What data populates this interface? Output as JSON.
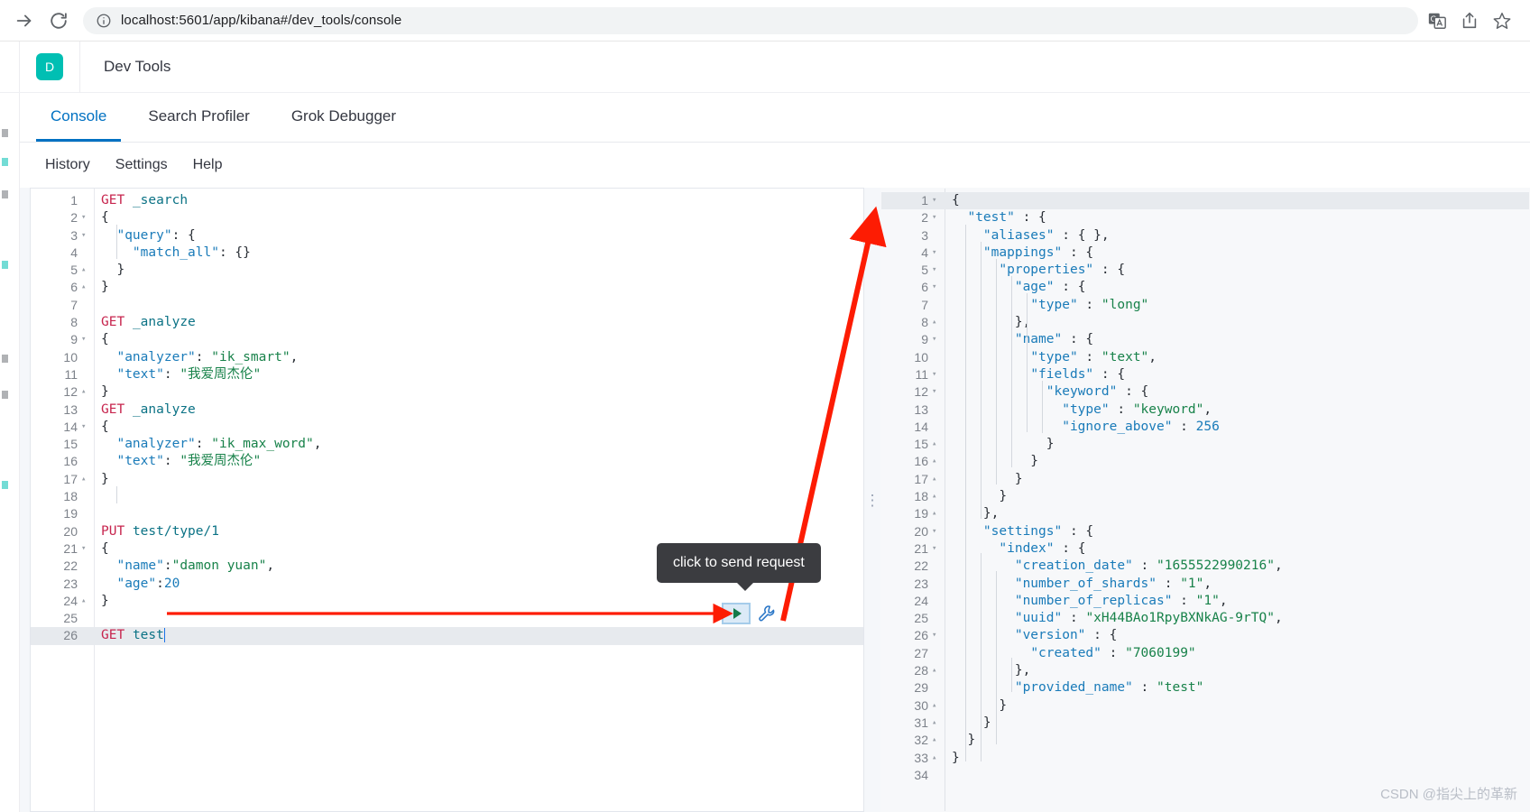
{
  "browser": {
    "url_host": "localhost:5601",
    "url_path": "/app/kibana#/dev_tools/console",
    "url_full": "localhost:5601/app/kibana#/dev_tools/console",
    "icons": {
      "forward": "forward-arrow-icon",
      "reload": "reload-icon",
      "info": "site-info-icon",
      "translate": "translate-icon",
      "share": "share-icon",
      "bookmark": "bookmark-star-icon"
    }
  },
  "header": {
    "logo_letter": "D",
    "logo_color": "#00bfb3",
    "title": "Dev Tools"
  },
  "tabs": [
    {
      "label": "Console",
      "active": true
    },
    {
      "label": "Search Profiler",
      "active": false
    },
    {
      "label": "Grok Debugger",
      "active": false
    }
  ],
  "submenu": [
    {
      "label": "History"
    },
    {
      "label": "Settings"
    },
    {
      "label": "Help"
    }
  ],
  "accent_color": "#0071c2",
  "request_editor": {
    "name": "console-request-editor",
    "highlighted_line": 26,
    "caret_line": 26,
    "lines": [
      {
        "n": 1,
        "fold": "",
        "tokens": [
          {
            "c": "t-method",
            "t": "GET"
          },
          {
            "c": "t-plain",
            "t": " "
          },
          {
            "c": "t-url",
            "t": "_search"
          }
        ]
      },
      {
        "n": 2,
        "fold": "▾",
        "tokens": [
          {
            "c": "t-punc",
            "t": "{"
          }
        ]
      },
      {
        "n": 3,
        "fold": "▾",
        "tokens": [
          {
            "c": "t-plain",
            "t": "  "
          },
          {
            "c": "t-key",
            "t": "\"query\""
          },
          {
            "c": "t-punc",
            "t": ": {"
          }
        ]
      },
      {
        "n": 4,
        "fold": "",
        "tokens": [
          {
            "c": "t-plain",
            "t": "    "
          },
          {
            "c": "t-key",
            "t": "\"match_all\""
          },
          {
            "c": "t-punc",
            "t": ": {}"
          }
        ]
      },
      {
        "n": 5,
        "fold": "▴",
        "tokens": [
          {
            "c": "t-punc",
            "t": "  }"
          }
        ]
      },
      {
        "n": 6,
        "fold": "▴",
        "tokens": [
          {
            "c": "t-punc",
            "t": "}"
          }
        ]
      },
      {
        "n": 7,
        "fold": "",
        "tokens": []
      },
      {
        "n": 8,
        "fold": "",
        "tokens": [
          {
            "c": "t-method",
            "t": "GET"
          },
          {
            "c": "t-plain",
            "t": " "
          },
          {
            "c": "t-url",
            "t": "_analyze"
          }
        ]
      },
      {
        "n": 9,
        "fold": "▾",
        "tokens": [
          {
            "c": "t-punc",
            "t": "{"
          }
        ]
      },
      {
        "n": 10,
        "fold": "",
        "tokens": [
          {
            "c": "t-plain",
            "t": "  "
          },
          {
            "c": "t-key",
            "t": "\"analyzer\""
          },
          {
            "c": "t-punc",
            "t": ": "
          },
          {
            "c": "t-str",
            "t": "\"ik_smart\""
          },
          {
            "c": "t-punc",
            "t": ","
          }
        ]
      },
      {
        "n": 11,
        "fold": "",
        "tokens": [
          {
            "c": "t-plain",
            "t": "  "
          },
          {
            "c": "t-key",
            "t": "\"text\""
          },
          {
            "c": "t-punc",
            "t": ": "
          },
          {
            "c": "t-str",
            "t": "\"我爱周杰伦\""
          }
        ]
      },
      {
        "n": 12,
        "fold": "▴",
        "tokens": [
          {
            "c": "t-punc",
            "t": "}"
          }
        ]
      },
      {
        "n": 13,
        "fold": "",
        "tokens": [
          {
            "c": "t-method",
            "t": "GET"
          },
          {
            "c": "t-plain",
            "t": " "
          },
          {
            "c": "t-url",
            "t": "_analyze"
          }
        ]
      },
      {
        "n": 14,
        "fold": "▾",
        "tokens": [
          {
            "c": "t-punc",
            "t": "{"
          }
        ]
      },
      {
        "n": 15,
        "fold": "",
        "tokens": [
          {
            "c": "t-plain",
            "t": "  "
          },
          {
            "c": "t-key",
            "t": "\"analyzer\""
          },
          {
            "c": "t-punc",
            "t": ": "
          },
          {
            "c": "t-str",
            "t": "\"ik_max_word\""
          },
          {
            "c": "t-punc",
            "t": ","
          }
        ]
      },
      {
        "n": 16,
        "fold": "",
        "tokens": [
          {
            "c": "t-plain",
            "t": "  "
          },
          {
            "c": "t-key",
            "t": "\"text\""
          },
          {
            "c": "t-punc",
            "t": ": "
          },
          {
            "c": "t-str",
            "t": "\"我爱周杰伦\""
          }
        ]
      },
      {
        "n": 17,
        "fold": "▴",
        "tokens": [
          {
            "c": "t-punc",
            "t": "}"
          }
        ]
      },
      {
        "n": 18,
        "fold": "",
        "tokens": []
      },
      {
        "n": 19,
        "fold": "",
        "tokens": []
      },
      {
        "n": 20,
        "fold": "",
        "tokens": [
          {
            "c": "t-method",
            "t": "PUT"
          },
          {
            "c": "t-plain",
            "t": " "
          },
          {
            "c": "t-url",
            "t": "test/type/1"
          }
        ]
      },
      {
        "n": 21,
        "fold": "▾",
        "tokens": [
          {
            "c": "t-punc",
            "t": "{"
          }
        ]
      },
      {
        "n": 22,
        "fold": "",
        "tokens": [
          {
            "c": "t-plain",
            "t": "  "
          },
          {
            "c": "t-key",
            "t": "\"name\""
          },
          {
            "c": "t-punc",
            "t": ":"
          },
          {
            "c": "t-str",
            "t": "\"damon yuan\""
          },
          {
            "c": "t-punc",
            "t": ","
          }
        ]
      },
      {
        "n": 23,
        "fold": "",
        "tokens": [
          {
            "c": "t-plain",
            "t": "  "
          },
          {
            "c": "t-key",
            "t": "\"age\""
          },
          {
            "c": "t-punc",
            "t": ":"
          },
          {
            "c": "t-num",
            "t": "20"
          }
        ]
      },
      {
        "n": 24,
        "fold": "▴",
        "tokens": [
          {
            "c": "t-punc",
            "t": "}"
          }
        ]
      },
      {
        "n": 25,
        "fold": "",
        "tokens": []
      },
      {
        "n": 26,
        "fold": "",
        "tokens": [
          {
            "c": "t-method",
            "t": "GET"
          },
          {
            "c": "t-plain",
            "t": " "
          },
          {
            "c": "t-url",
            "t": "test"
          }
        ]
      }
    ]
  },
  "response_editor": {
    "name": "console-response-viewer",
    "highlighted_line": 1,
    "lines": [
      {
        "n": 1,
        "fold": "▾",
        "tokens": [
          {
            "c": "t-punc",
            "t": "{"
          }
        ]
      },
      {
        "n": 2,
        "fold": "▾",
        "tokens": [
          {
            "c": "t-plain",
            "t": "  "
          },
          {
            "c": "t-key",
            "t": "\"test\""
          },
          {
            "c": "t-punc",
            "t": " : {"
          }
        ]
      },
      {
        "n": 3,
        "fold": "",
        "tokens": [
          {
            "c": "t-plain",
            "t": "    "
          },
          {
            "c": "t-key",
            "t": "\"aliases\""
          },
          {
            "c": "t-punc",
            "t": " : { },"
          }
        ]
      },
      {
        "n": 4,
        "fold": "▾",
        "tokens": [
          {
            "c": "t-plain",
            "t": "    "
          },
          {
            "c": "t-key",
            "t": "\"mappings\""
          },
          {
            "c": "t-punc",
            "t": " : {"
          }
        ]
      },
      {
        "n": 5,
        "fold": "▾",
        "tokens": [
          {
            "c": "t-plain",
            "t": "      "
          },
          {
            "c": "t-key",
            "t": "\"properties\""
          },
          {
            "c": "t-punc",
            "t": " : {"
          }
        ]
      },
      {
        "n": 6,
        "fold": "▾",
        "tokens": [
          {
            "c": "t-plain",
            "t": "        "
          },
          {
            "c": "t-key",
            "t": "\"age\""
          },
          {
            "c": "t-punc",
            "t": " : {"
          }
        ]
      },
      {
        "n": 7,
        "fold": "",
        "tokens": [
          {
            "c": "t-plain",
            "t": "          "
          },
          {
            "c": "t-key",
            "t": "\"type\""
          },
          {
            "c": "t-punc",
            "t": " : "
          },
          {
            "c": "t-str",
            "t": "\"long\""
          }
        ]
      },
      {
        "n": 8,
        "fold": "▴",
        "tokens": [
          {
            "c": "t-punc",
            "t": "        },"
          }
        ]
      },
      {
        "n": 9,
        "fold": "▾",
        "tokens": [
          {
            "c": "t-plain",
            "t": "        "
          },
          {
            "c": "t-key",
            "t": "\"name\""
          },
          {
            "c": "t-punc",
            "t": " : {"
          }
        ]
      },
      {
        "n": 10,
        "fold": "",
        "tokens": [
          {
            "c": "t-plain",
            "t": "          "
          },
          {
            "c": "t-key",
            "t": "\"type\""
          },
          {
            "c": "t-punc",
            "t": " : "
          },
          {
            "c": "t-str",
            "t": "\"text\""
          },
          {
            "c": "t-punc",
            "t": ","
          }
        ]
      },
      {
        "n": 11,
        "fold": "▾",
        "tokens": [
          {
            "c": "t-plain",
            "t": "          "
          },
          {
            "c": "t-key",
            "t": "\"fields\""
          },
          {
            "c": "t-punc",
            "t": " : {"
          }
        ]
      },
      {
        "n": 12,
        "fold": "▾",
        "tokens": [
          {
            "c": "t-plain",
            "t": "            "
          },
          {
            "c": "t-key",
            "t": "\"keyword\""
          },
          {
            "c": "t-punc",
            "t": " : {"
          }
        ]
      },
      {
        "n": 13,
        "fold": "",
        "tokens": [
          {
            "c": "t-plain",
            "t": "              "
          },
          {
            "c": "t-key",
            "t": "\"type\""
          },
          {
            "c": "t-punc",
            "t": " : "
          },
          {
            "c": "t-str",
            "t": "\"keyword\""
          },
          {
            "c": "t-punc",
            "t": ","
          }
        ]
      },
      {
        "n": 14,
        "fold": "",
        "tokens": [
          {
            "c": "t-plain",
            "t": "              "
          },
          {
            "c": "t-key",
            "t": "\"ignore_above\""
          },
          {
            "c": "t-punc",
            "t": " : "
          },
          {
            "c": "t-num",
            "t": "256"
          }
        ]
      },
      {
        "n": 15,
        "fold": "▴",
        "tokens": [
          {
            "c": "t-punc",
            "t": "            }"
          }
        ]
      },
      {
        "n": 16,
        "fold": "▴",
        "tokens": [
          {
            "c": "t-punc",
            "t": "          }"
          }
        ]
      },
      {
        "n": 17,
        "fold": "▴",
        "tokens": [
          {
            "c": "t-punc",
            "t": "        }"
          }
        ]
      },
      {
        "n": 18,
        "fold": "▴",
        "tokens": [
          {
            "c": "t-punc",
            "t": "      }"
          }
        ]
      },
      {
        "n": 19,
        "fold": "▴",
        "tokens": [
          {
            "c": "t-punc",
            "t": "    },"
          }
        ]
      },
      {
        "n": 20,
        "fold": "▾",
        "tokens": [
          {
            "c": "t-plain",
            "t": "    "
          },
          {
            "c": "t-key",
            "t": "\"settings\""
          },
          {
            "c": "t-punc",
            "t": " : {"
          }
        ]
      },
      {
        "n": 21,
        "fold": "▾",
        "tokens": [
          {
            "c": "t-plain",
            "t": "      "
          },
          {
            "c": "t-key",
            "t": "\"index\""
          },
          {
            "c": "t-punc",
            "t": " : {"
          }
        ]
      },
      {
        "n": 22,
        "fold": "",
        "tokens": [
          {
            "c": "t-plain",
            "t": "        "
          },
          {
            "c": "t-key",
            "t": "\"creation_date\""
          },
          {
            "c": "t-punc",
            "t": " : "
          },
          {
            "c": "t-str",
            "t": "\"1655522990216\""
          },
          {
            "c": "t-punc",
            "t": ","
          }
        ]
      },
      {
        "n": 23,
        "fold": "",
        "tokens": [
          {
            "c": "t-plain",
            "t": "        "
          },
          {
            "c": "t-key",
            "t": "\"number_of_shards\""
          },
          {
            "c": "t-punc",
            "t": " : "
          },
          {
            "c": "t-str",
            "t": "\"1\""
          },
          {
            "c": "t-punc",
            "t": ","
          }
        ]
      },
      {
        "n": 24,
        "fold": "",
        "tokens": [
          {
            "c": "t-plain",
            "t": "        "
          },
          {
            "c": "t-key",
            "t": "\"number_of_replicas\""
          },
          {
            "c": "t-punc",
            "t": " : "
          },
          {
            "c": "t-str",
            "t": "\"1\""
          },
          {
            "c": "t-punc",
            "t": ","
          }
        ]
      },
      {
        "n": 25,
        "fold": "",
        "tokens": [
          {
            "c": "t-plain",
            "t": "        "
          },
          {
            "c": "t-key",
            "t": "\"uuid\""
          },
          {
            "c": "t-punc",
            "t": " : "
          },
          {
            "c": "t-str",
            "t": "\"xH44BAo1RpyBXNkAG-9rTQ\""
          },
          {
            "c": "t-punc",
            "t": ","
          }
        ]
      },
      {
        "n": 26,
        "fold": "▾",
        "tokens": [
          {
            "c": "t-plain",
            "t": "        "
          },
          {
            "c": "t-key",
            "t": "\"version\""
          },
          {
            "c": "t-punc",
            "t": " : {"
          }
        ]
      },
      {
        "n": 27,
        "fold": "",
        "tokens": [
          {
            "c": "t-plain",
            "t": "          "
          },
          {
            "c": "t-key",
            "t": "\"created\""
          },
          {
            "c": "t-punc",
            "t": " : "
          },
          {
            "c": "t-str",
            "t": "\"7060199\""
          }
        ]
      },
      {
        "n": 28,
        "fold": "▴",
        "tokens": [
          {
            "c": "t-punc",
            "t": "        },"
          }
        ]
      },
      {
        "n": 29,
        "fold": "",
        "tokens": [
          {
            "c": "t-plain",
            "t": "        "
          },
          {
            "c": "t-key",
            "t": "\"provided_name\""
          },
          {
            "c": "t-punc",
            "t": " : "
          },
          {
            "c": "t-str",
            "t": "\"test\""
          }
        ]
      },
      {
        "n": 30,
        "fold": "▴",
        "tokens": [
          {
            "c": "t-punc",
            "t": "      }"
          }
        ]
      },
      {
        "n": 31,
        "fold": "▴",
        "tokens": [
          {
            "c": "t-punc",
            "t": "    }"
          }
        ]
      },
      {
        "n": 32,
        "fold": "▴",
        "tokens": [
          {
            "c": "t-punc",
            "t": "  }"
          }
        ]
      },
      {
        "n": 33,
        "fold": "▴",
        "tokens": [
          {
            "c": "t-punc",
            "t": "}"
          }
        ]
      },
      {
        "n": 34,
        "fold": "",
        "tokens": []
      }
    ]
  },
  "actions": {
    "play_label": "play-button",
    "wrench_label": "wrench-button"
  },
  "tooltip": {
    "text": "click to send request"
  },
  "annotations": {
    "arrow_color": "#fd1c03"
  },
  "watermark": "CSDN @指尖上的革新"
}
